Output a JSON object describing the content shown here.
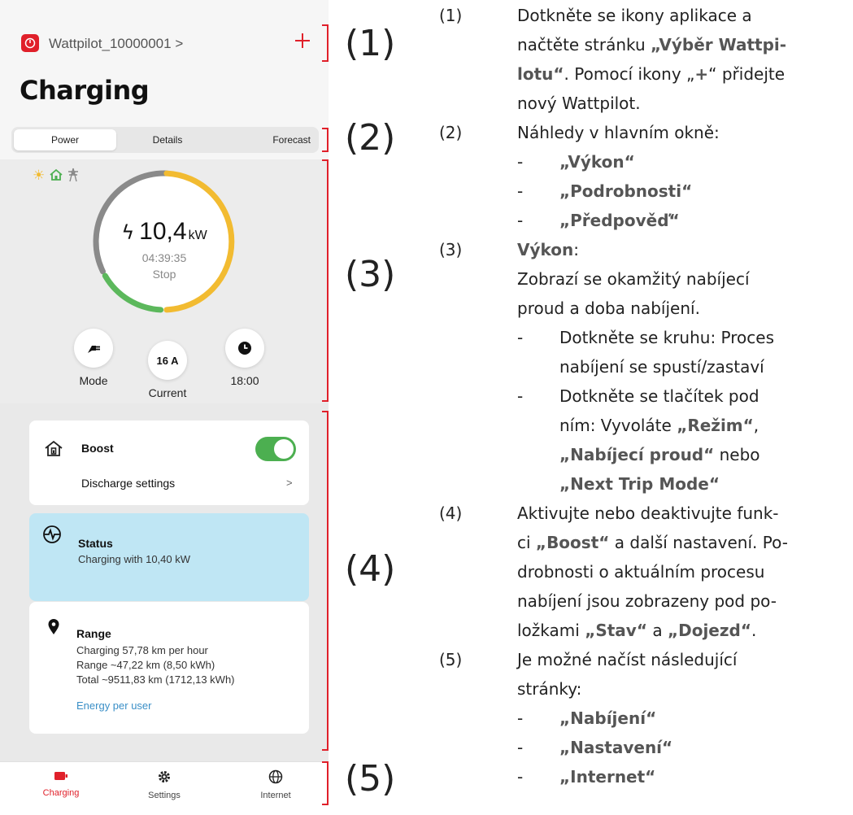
{
  "app": {
    "device_name": "Wattpilot_10000001 >",
    "add_label": "+",
    "page_title": "Charging",
    "brand_color": "#e0202a"
  },
  "tabs": [
    {
      "label": "Power",
      "active": true
    },
    {
      "label": "Details",
      "active": false
    },
    {
      "label": "Forecast",
      "active": false
    }
  ],
  "power": {
    "sources": [
      "sun-icon",
      "house-icon",
      "grid-pylon-icon"
    ],
    "value": "10,4",
    "unit": "kW",
    "timer": "04:39:35",
    "action": "Stop",
    "ring_colors": {
      "grid": "#8a8a8a",
      "solar": "#f2bb31",
      "battery": "#5cb85c"
    }
  },
  "controls": {
    "mode_label": "Mode",
    "current_value": "16 A",
    "current_label": "Current",
    "time_label": "18:00"
  },
  "boost": {
    "title": "Boost",
    "enabled": true,
    "discharge_label": "Discharge settings",
    "chevron": ">"
  },
  "status": {
    "title": "Status",
    "text": "Charging with 10,40 kW"
  },
  "range": {
    "title": "Range",
    "line1": "Charging 57,78 km per hour",
    "line2": "Range ~47,22 km (8,50 kWh)",
    "line3": "Total ~9511,83 km (1712,13 kWh)",
    "link": "Energy per user"
  },
  "nav": [
    {
      "label": "Charging",
      "icon": "battery-icon",
      "active": true
    },
    {
      "label": "Settings",
      "icon": "gear-icon",
      "active": false
    },
    {
      "label": "Internet",
      "icon": "globe-icon",
      "active": false
    }
  ],
  "callouts": [
    "(1)",
    "(2)",
    "(3)",
    "(4)",
    "(5)"
  ],
  "doc": {
    "s1_num": "(1)",
    "s1_l1": "Dotkněte se ikony aplikace a",
    "s1_l2a": "načtěte stránku ",
    "s1_l2b": "„Výběr Wattpi-",
    "s1_l3a": "lotu“",
    "s1_l3b": ". Pomocí ikony „",
    "s1_l3c": "+",
    "s1_l3d": "“ přidejte",
    "s1_l4": "nový Wattpilot.",
    "s2_num": "(2)",
    "s2_l1": "Náhledy v hlavním okně:",
    "s2_items": [
      "„Výkon“",
      "„Podrobnosti“",
      "„Předpověď“"
    ],
    "s3_num": "(3)",
    "s3_title": "Výkon",
    "s3_colon": ":",
    "s3_l2": "Zobrazí se okamžitý nabíjecí",
    "s3_l3": "proud a doba nabíjení.",
    "s3_b1_l1": "Dotkněte se kruhu: Proces",
    "s3_b1_l2": "nabíjení se spustí/zastaví",
    "s3_b2_l1": "Dotkněte se tlačítek pod",
    "s3_b2_l2a": "ním: Vyvoláte ",
    "s3_b2_l2b": "„Režim“",
    "s3_b2_l2c": ",",
    "s3_b2_l3a": "„Nabíjecí proud“",
    "s3_b2_l3b": " nebo",
    "s3_b2_l4": "„Next Trip Mode“",
    "s4_num": "(4)",
    "s4_l1": "Aktivujte nebo deaktivujte funk-",
    "s4_l2a": "ci ",
    "s4_l2b": "„Boost“",
    "s4_l2c": " a další nastavení. Po-",
    "s4_l3": "drobnosti o aktuálním procesu",
    "s4_l4": "nabíjení jsou zobrazeny pod po-",
    "s4_l5a": "ložkami ",
    "s4_l5b": "„Stav“",
    "s4_l5c": " a ",
    "s4_l5d": "„Dojezd“",
    "s4_l5e": ".",
    "s5_num": "(5)",
    "s5_l1": "Je možné načíst následující",
    "s5_l2": "stránky:",
    "s5_items": [
      "„Nabíjení“",
      "„Nastavení“",
      "„Internet“"
    ],
    "dash": "-"
  }
}
